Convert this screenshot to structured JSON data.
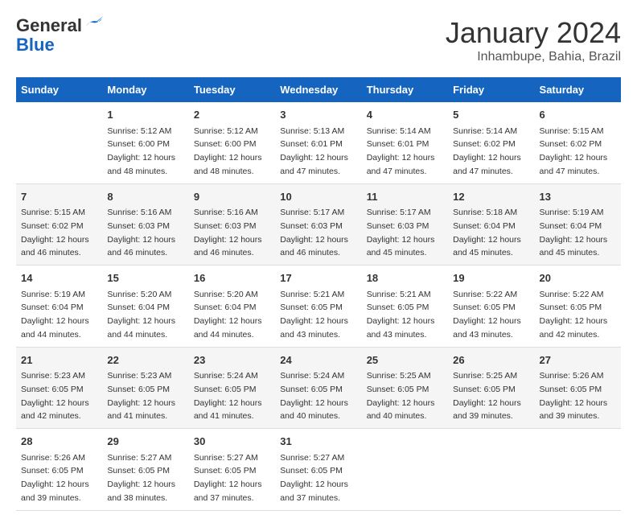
{
  "logo": {
    "general": "General",
    "blue": "Blue"
  },
  "title": "January 2024",
  "location": "Inhambupe, Bahia, Brazil",
  "days_of_week": [
    "Sunday",
    "Monday",
    "Tuesday",
    "Wednesday",
    "Thursday",
    "Friday",
    "Saturday"
  ],
  "weeks": [
    [
      {
        "day": "",
        "info": ""
      },
      {
        "day": "1",
        "info": "Sunrise: 5:12 AM\nSunset: 6:00 PM\nDaylight: 12 hours\nand 48 minutes."
      },
      {
        "day": "2",
        "info": "Sunrise: 5:12 AM\nSunset: 6:00 PM\nDaylight: 12 hours\nand 48 minutes."
      },
      {
        "day": "3",
        "info": "Sunrise: 5:13 AM\nSunset: 6:01 PM\nDaylight: 12 hours\nand 47 minutes."
      },
      {
        "day": "4",
        "info": "Sunrise: 5:14 AM\nSunset: 6:01 PM\nDaylight: 12 hours\nand 47 minutes."
      },
      {
        "day": "5",
        "info": "Sunrise: 5:14 AM\nSunset: 6:02 PM\nDaylight: 12 hours\nand 47 minutes."
      },
      {
        "day": "6",
        "info": "Sunrise: 5:15 AM\nSunset: 6:02 PM\nDaylight: 12 hours\nand 47 minutes."
      }
    ],
    [
      {
        "day": "7",
        "info": "Sunrise: 5:15 AM\nSunset: 6:02 PM\nDaylight: 12 hours\nand 46 minutes."
      },
      {
        "day": "8",
        "info": "Sunrise: 5:16 AM\nSunset: 6:03 PM\nDaylight: 12 hours\nand 46 minutes."
      },
      {
        "day": "9",
        "info": "Sunrise: 5:16 AM\nSunset: 6:03 PM\nDaylight: 12 hours\nand 46 minutes."
      },
      {
        "day": "10",
        "info": "Sunrise: 5:17 AM\nSunset: 6:03 PM\nDaylight: 12 hours\nand 46 minutes."
      },
      {
        "day": "11",
        "info": "Sunrise: 5:17 AM\nSunset: 6:03 PM\nDaylight: 12 hours\nand 45 minutes."
      },
      {
        "day": "12",
        "info": "Sunrise: 5:18 AM\nSunset: 6:04 PM\nDaylight: 12 hours\nand 45 minutes."
      },
      {
        "day": "13",
        "info": "Sunrise: 5:19 AM\nSunset: 6:04 PM\nDaylight: 12 hours\nand 45 minutes."
      }
    ],
    [
      {
        "day": "14",
        "info": "Sunrise: 5:19 AM\nSunset: 6:04 PM\nDaylight: 12 hours\nand 44 minutes."
      },
      {
        "day": "15",
        "info": "Sunrise: 5:20 AM\nSunset: 6:04 PM\nDaylight: 12 hours\nand 44 minutes."
      },
      {
        "day": "16",
        "info": "Sunrise: 5:20 AM\nSunset: 6:04 PM\nDaylight: 12 hours\nand 44 minutes."
      },
      {
        "day": "17",
        "info": "Sunrise: 5:21 AM\nSunset: 6:05 PM\nDaylight: 12 hours\nand 43 minutes."
      },
      {
        "day": "18",
        "info": "Sunrise: 5:21 AM\nSunset: 6:05 PM\nDaylight: 12 hours\nand 43 minutes."
      },
      {
        "day": "19",
        "info": "Sunrise: 5:22 AM\nSunset: 6:05 PM\nDaylight: 12 hours\nand 43 minutes."
      },
      {
        "day": "20",
        "info": "Sunrise: 5:22 AM\nSunset: 6:05 PM\nDaylight: 12 hours\nand 42 minutes."
      }
    ],
    [
      {
        "day": "21",
        "info": "Sunrise: 5:23 AM\nSunset: 6:05 PM\nDaylight: 12 hours\nand 42 minutes."
      },
      {
        "day": "22",
        "info": "Sunrise: 5:23 AM\nSunset: 6:05 PM\nDaylight: 12 hours\nand 41 minutes."
      },
      {
        "day": "23",
        "info": "Sunrise: 5:24 AM\nSunset: 6:05 PM\nDaylight: 12 hours\nand 41 minutes."
      },
      {
        "day": "24",
        "info": "Sunrise: 5:24 AM\nSunset: 6:05 PM\nDaylight: 12 hours\nand 40 minutes."
      },
      {
        "day": "25",
        "info": "Sunrise: 5:25 AM\nSunset: 6:05 PM\nDaylight: 12 hours\nand 40 minutes."
      },
      {
        "day": "26",
        "info": "Sunrise: 5:25 AM\nSunset: 6:05 PM\nDaylight: 12 hours\nand 39 minutes."
      },
      {
        "day": "27",
        "info": "Sunrise: 5:26 AM\nSunset: 6:05 PM\nDaylight: 12 hours\nand 39 minutes."
      }
    ],
    [
      {
        "day": "28",
        "info": "Sunrise: 5:26 AM\nSunset: 6:05 PM\nDaylight: 12 hours\nand 39 minutes."
      },
      {
        "day": "29",
        "info": "Sunrise: 5:27 AM\nSunset: 6:05 PM\nDaylight: 12 hours\nand 38 minutes."
      },
      {
        "day": "30",
        "info": "Sunrise: 5:27 AM\nSunset: 6:05 PM\nDaylight: 12 hours\nand 37 minutes."
      },
      {
        "day": "31",
        "info": "Sunrise: 5:27 AM\nSunset: 6:05 PM\nDaylight: 12 hours\nand 37 minutes."
      },
      {
        "day": "",
        "info": ""
      },
      {
        "day": "",
        "info": ""
      },
      {
        "day": "",
        "info": ""
      }
    ]
  ]
}
